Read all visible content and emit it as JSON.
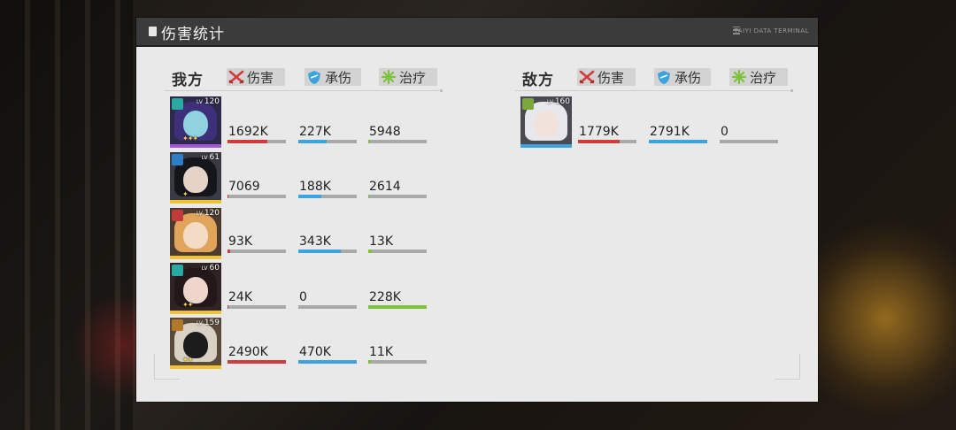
{
  "header": {
    "title": "伤害统计",
    "brand": "TAIYI DATA TERMINAL"
  },
  "colors": {
    "damage": "#d23b3b",
    "taken": "#3aa3e0",
    "heal": "#7ec23a",
    "bar_bg": "#a9a9a9"
  },
  "legend": {
    "damage": "伤害",
    "taken": "承伤",
    "heal": "治疗"
  },
  "ours": {
    "label": "我方",
    "members": [
      {
        "level": "120",
        "class_icon": "gear-flower-icon",
        "rarity_color": "#a05ad8",
        "damage": "1692K",
        "damage_fill": 0.68,
        "taken": "227K",
        "taken_fill": 0.48,
        "heal": "5948",
        "heal_fill": 0.03
      },
      {
        "level": "61",
        "class_icon": "shield-cycle-icon",
        "rarity_color": "#f1c232",
        "damage": "7069",
        "damage_fill": 0.01,
        "taken": "188K",
        "taken_fill": 0.4,
        "heal": "2614",
        "heal_fill": 0.01
      },
      {
        "level": "120",
        "class_icon": "tower-icon",
        "rarity_color": "#f1c232",
        "damage": "93K",
        "damage_fill": 0.04,
        "taken": "343K",
        "taken_fill": 0.73,
        "heal": "13K",
        "heal_fill": 0.06
      },
      {
        "level": "60",
        "class_icon": "gear-flower-icon",
        "rarity_color": "#f1c232",
        "damage": "24K",
        "damage_fill": 0.01,
        "taken": "0",
        "taken_fill": 0,
        "heal": "228K",
        "heal_fill": 1.0
      },
      {
        "level": "159",
        "class_icon": "arrow-circle-icon",
        "rarity_color": "#f1c232",
        "damage": "2490K",
        "damage_fill": 1.0,
        "taken": "470K",
        "taken_fill": 1.0,
        "heal": "11K",
        "heal_fill": 0.05
      }
    ]
  },
  "enemy": {
    "label": "敌方",
    "members": [
      {
        "level": "160",
        "class_icon": "leaf-icon",
        "rarity_color": "#3aa3e0",
        "damage": "1779K",
        "damage_fill": 0.71,
        "taken": "2791K",
        "taken_fill": 1.0,
        "heal": "0",
        "heal_fill": 0
      }
    ]
  }
}
